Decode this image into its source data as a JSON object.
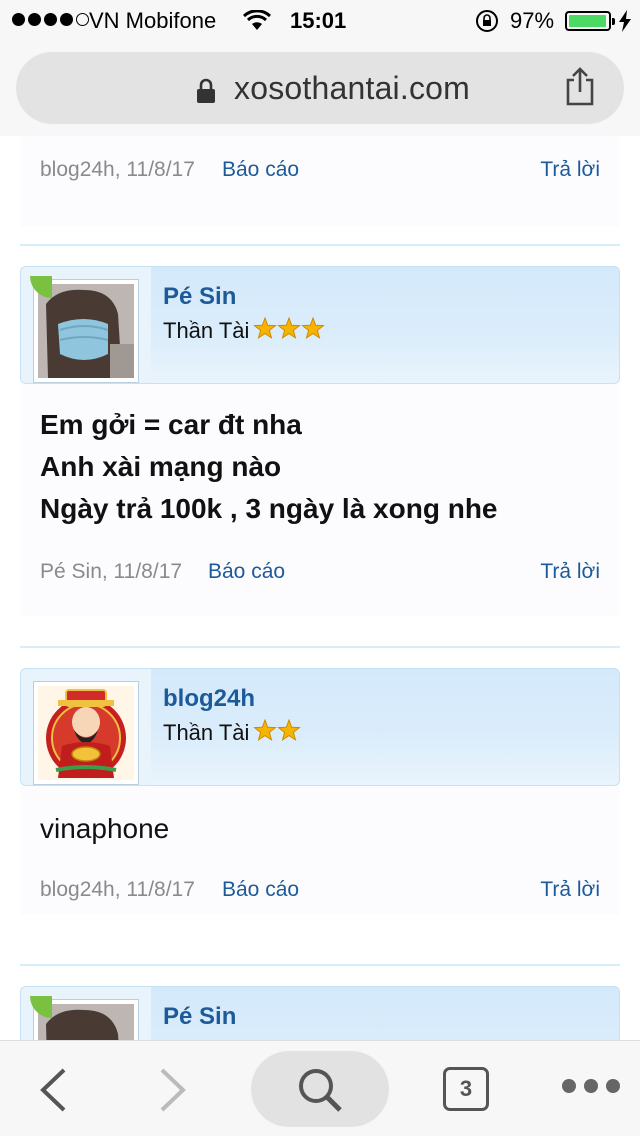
{
  "status_bar": {
    "carrier": "VN Mobifone",
    "time": "15:01",
    "battery_percent": "97%",
    "battery_level": 0.97,
    "signal_bars": 4,
    "signal_total": 5
  },
  "browser": {
    "url": "xosothantai.com"
  },
  "posts": [
    {
      "partial": true,
      "lines": [],
      "author": "blog24h",
      "date": "11/8/17",
      "meta": "blog24h, 11/8/17",
      "report_label": "Báo cáo",
      "reply_label": "Trả lời"
    },
    {
      "username": "Pé Sin",
      "rank": "Thần Tài",
      "stars": 3,
      "avatar": "masked-person-photo",
      "lines": [
        "Em gởi = car đt nha",
        "Anh xài mạng nào",
        "Ngày trả 100k , 3 ngày là xong nhe"
      ],
      "bold": true,
      "meta": "Pé Sin, 11/8/17",
      "report_label": "Báo cáo",
      "reply_label": "Trả lời"
    },
    {
      "username": "blog24h",
      "rank": "Thần Tài",
      "stars": 2,
      "avatar": "god-of-wealth-image",
      "lines": [
        "vinaphone"
      ],
      "bold": false,
      "meta": "blog24h, 11/8/17",
      "report_label": "Báo cáo",
      "reply_label": "Trả lời"
    },
    {
      "partial": true,
      "username": "Pé Sin",
      "avatar": "masked-person-photo"
    }
  ],
  "colors": {
    "link": "#1d5a99",
    "header_bg": "#d4e9fb",
    "separator": "#d7edf9",
    "star": "#f4b400"
  },
  "toolbar": {
    "tabs_count": "3"
  }
}
